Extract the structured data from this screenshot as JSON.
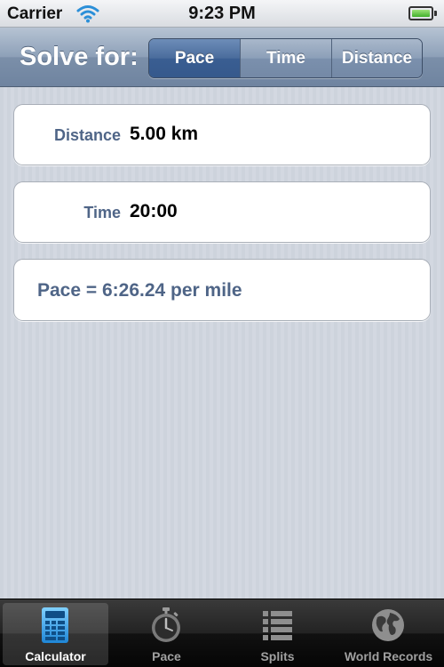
{
  "status_bar": {
    "carrier": "Carrier",
    "time": "9:23 PM"
  },
  "nav_bar": {
    "title": "Solve for:",
    "segments": [
      {
        "label": "Pace",
        "selected": true
      },
      {
        "label": "Time",
        "selected": false
      },
      {
        "label": "Distance",
        "selected": false
      }
    ]
  },
  "form": {
    "distance": {
      "label": "Distance",
      "value": "5.00 km"
    },
    "time": {
      "label": "Time",
      "value": "20:00"
    },
    "result": "Pace = 6:26.24 per mile"
  },
  "tab_bar": {
    "items": [
      {
        "label": "Calculator",
        "icon": "calculator-icon",
        "selected": true
      },
      {
        "label": "Pace",
        "icon": "stopwatch-icon",
        "selected": false
      },
      {
        "label": "Splits",
        "icon": "list-icon",
        "selected": false
      },
      {
        "label": "World Records",
        "icon": "globe-icon",
        "selected": false
      }
    ]
  },
  "colors": {
    "accent": "#3a5e92",
    "label": "#4f6587",
    "selected_tab_icon": "#46a7e6"
  }
}
